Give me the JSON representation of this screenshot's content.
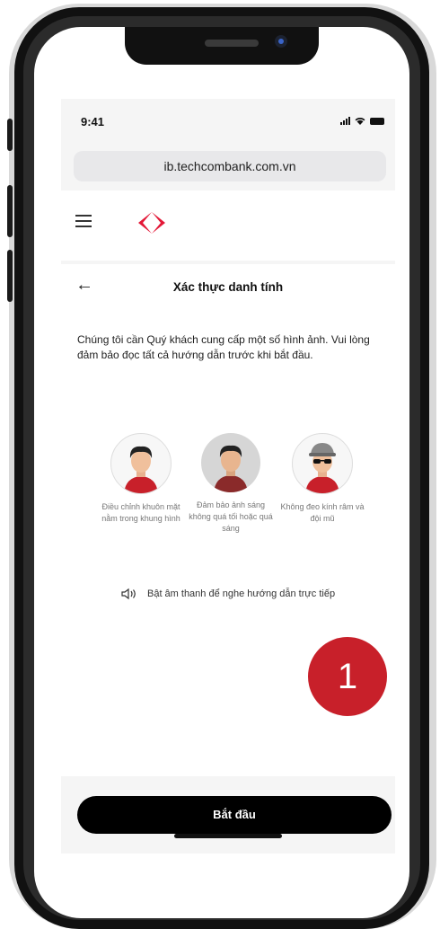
{
  "status_bar": {
    "time": "9:41"
  },
  "browser": {
    "url": "ib.techcombank.com.vn"
  },
  "app": {
    "brand_color": "#E31837",
    "header_icons": [
      "menu-icon",
      "techcombank-logo"
    ]
  },
  "page": {
    "back_icon": "arrow-left-icon",
    "title": "Xác thực danh tính",
    "intro": "Chúng tôi cần Quý khách cung cấp một số hình ảnh. Vui lòng đảm bảo đọc tất cả hướng dẫn trước khi bắt đầu.",
    "tips": [
      {
        "label": "Điều chỉnh khuôn mặt nằm trong khung hình",
        "icon": "face-in-frame-avatar"
      },
      {
        "label": "Đảm bảo ảnh sáng không quá tối hoặc quá sáng",
        "icon": "lighting-avatar"
      },
      {
        "label": "Không đeo kính râm và đội mũ",
        "icon": "no-glasses-hat-avatar"
      }
    ],
    "sound_icon": "speaker-icon",
    "sound_text": "Bật âm thanh để nghe hướng dẫn trực tiếp",
    "start_button": "Bắt đầu"
  },
  "annotation": {
    "step_number": "1",
    "color": "#C8202A"
  }
}
